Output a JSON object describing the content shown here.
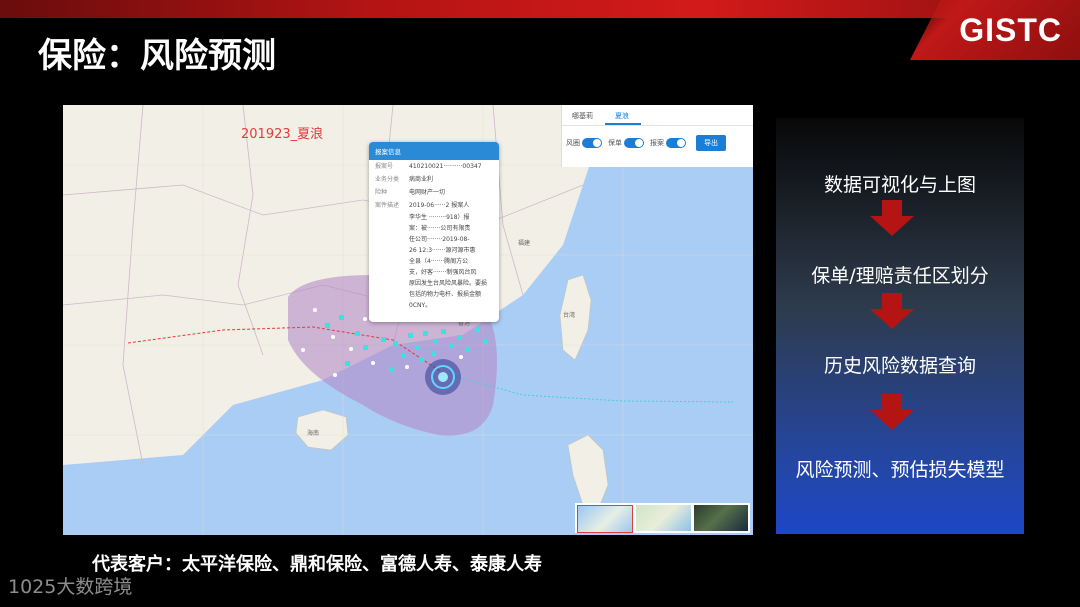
{
  "slide": {
    "logo": "GISTC",
    "title": "保险：风险预测",
    "customers": "代表客户：太平洋保险、鼎和保险、富德人寿、泰康人寿",
    "watermark": "1025大数跨境"
  },
  "map": {
    "typhoon_label": "201923_夏浪",
    "controls": {
      "tabs": [
        "哪基莉",
        "夏浪"
      ],
      "active_tab": "夏浪",
      "toggles": [
        "风圈",
        "保单",
        "报案"
      ],
      "export_label": "导出"
    },
    "popup": {
      "header": "报案信息",
      "rows": [
        {
          "key": "报案号",
          "value": "410210021··········00347"
        },
        {
          "key": "业务分类",
          "value": "病商业利"
        },
        {
          "key": "险种",
          "value": "电网财产一切"
        }
      ],
      "detail_key": "案件描述",
      "detail_lines": [
        "2019-06······2 报案人",
        "李华生 ·········918）报",
        "案：被·······公司有限责",
        "任公司········2019-08-",
        "26 12:3·······源河源市惠",
        "全县（4·······腾阁方公",
        "支，好客·······制强风台风",
        "原因发生台风险风暴险。要损",
        "包括的物力电杆、报损金额",
        "0CNY。"
      ]
    },
    "place_labels": [
      "台湾",
      "海南",
      "广东",
      "福建",
      "香港"
    ]
  },
  "process": {
    "steps": [
      "数据可视化与上图",
      "保单/理赔责任区划分",
      "历史风险数据查询",
      "风险预测、预估损失模型"
    ],
    "arrow_color": "#b41414"
  },
  "colors": {
    "accent_red": "#c41a1a",
    "risk_zone": "#c39fd1",
    "claim_points": "#3fe0e0",
    "sea": "#a9cdf5"
  }
}
